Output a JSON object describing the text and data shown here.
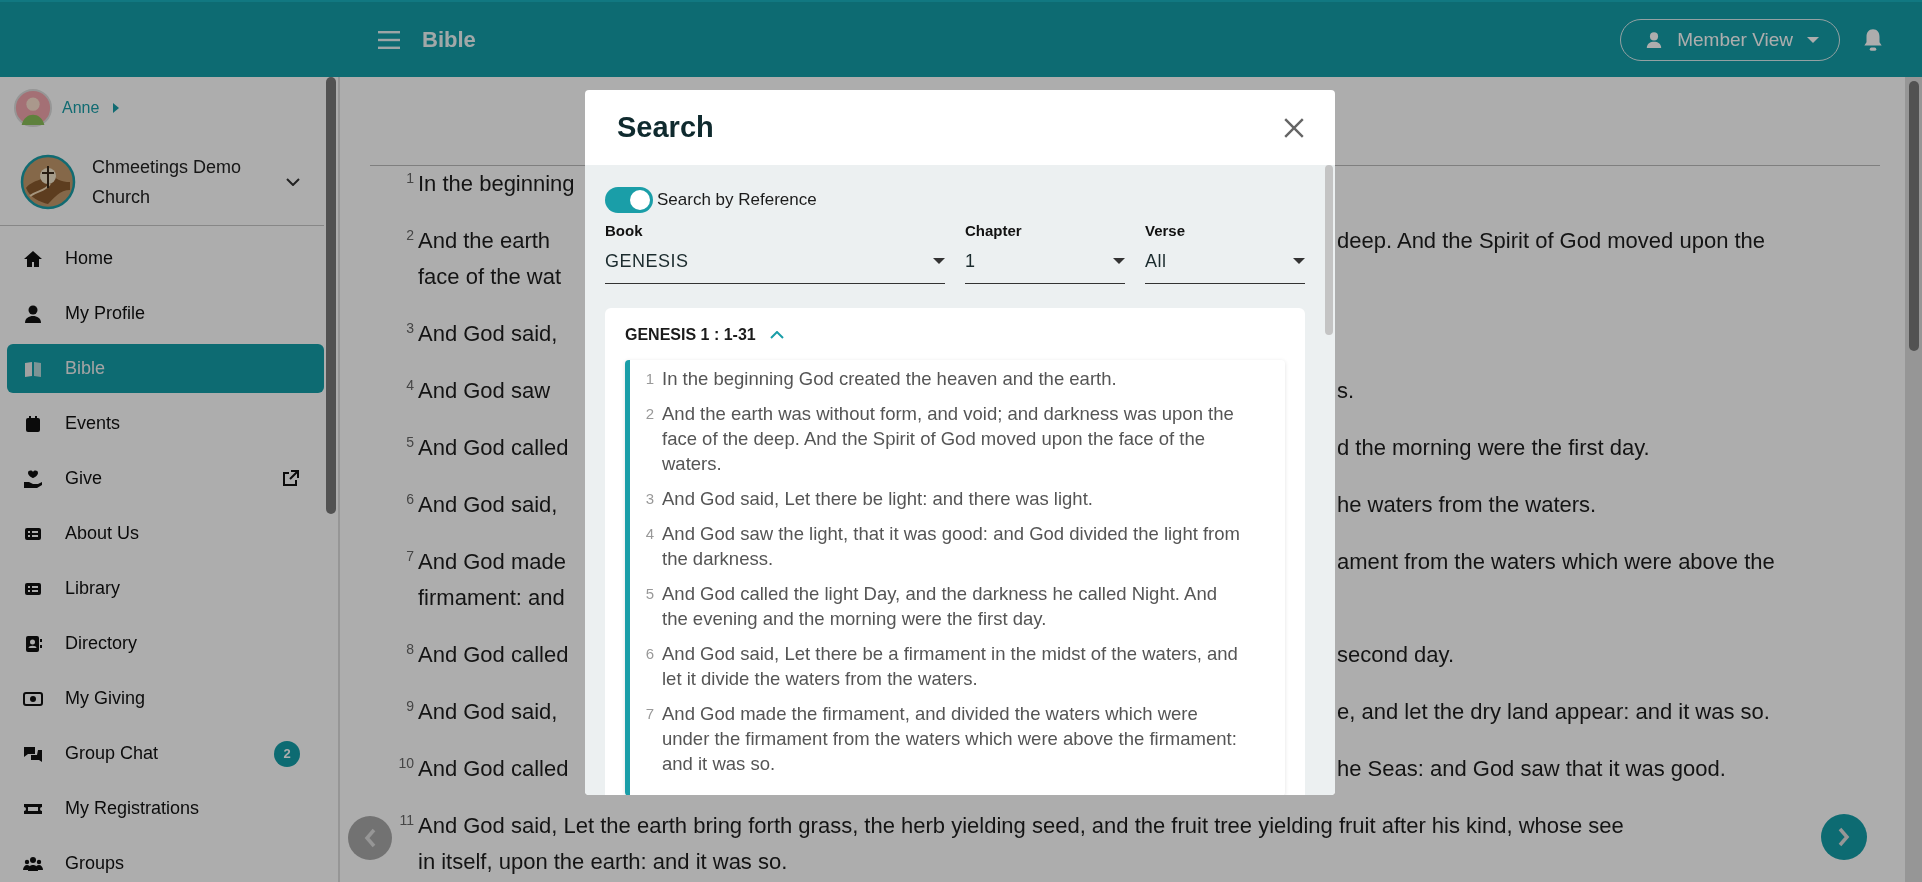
{
  "header": {
    "title": "Bible",
    "member_view": "Member View"
  },
  "sidebar": {
    "user": "Anne",
    "church": "Chmeetings Demo Church",
    "items": [
      {
        "kind": "home",
        "label": "Home",
        "selected": false
      },
      {
        "kind": "person",
        "label": "My Profile",
        "selected": false
      },
      {
        "kind": "book",
        "label": "Bible",
        "selected": true
      },
      {
        "kind": "calendar",
        "label": "Events",
        "selected": false
      },
      {
        "kind": "give",
        "label": "Give",
        "selected": false,
        "external": true
      },
      {
        "kind": "list",
        "label": "About Us",
        "selected": false
      },
      {
        "kind": "list",
        "label": "Library",
        "selected": false
      },
      {
        "kind": "contacts",
        "label": "Directory",
        "selected": false
      },
      {
        "kind": "cash",
        "label": "My Giving",
        "selected": false
      },
      {
        "kind": "chat",
        "label": "Group Chat",
        "selected": false,
        "badge": "2"
      },
      {
        "kind": "ticket",
        "label": "My Registrations",
        "selected": false
      },
      {
        "kind": "people",
        "label": "Groups",
        "selected": false
      }
    ]
  },
  "reader": {
    "verses": [
      {
        "number": "1",
        "lines": [
          {
            "left": "In the beginning"
          }
        ]
      },
      {
        "number": "2",
        "lines": [
          {
            "left": "And the earth",
            "right": "deep. And the Spirit of God moved upon the"
          },
          {
            "left": "face of the wat"
          }
        ]
      },
      {
        "number": "3",
        "lines": [
          {
            "left": "And God said,"
          }
        ]
      },
      {
        "number": "4",
        "lines": [
          {
            "left": "And God saw",
            "right": "s."
          }
        ]
      },
      {
        "number": "5",
        "lines": [
          {
            "left": "And God called",
            "right": "d the morning were the first day."
          }
        ]
      },
      {
        "number": "6",
        "lines": [
          {
            "left": "And God said,",
            "right": "he waters from the waters."
          }
        ]
      },
      {
        "number": "7",
        "lines": [
          {
            "left": "And God made",
            "right": "ament from the waters which were above the"
          },
          {
            "left": "firmament: and"
          }
        ]
      },
      {
        "number": "8",
        "lines": [
          {
            "left": "And God called",
            "right": "second day."
          }
        ]
      },
      {
        "number": "9",
        "lines": [
          {
            "left": "And God said,",
            "right": "e, and let the dry land appear: and it was so."
          }
        ]
      },
      {
        "number": "10",
        "lines": [
          {
            "left": "And God called",
            "right": "he Seas: and God saw that it was good."
          }
        ]
      },
      {
        "number": "11",
        "lines": [
          {
            "full": "And God said, Let the earth bring forth grass, the herb yielding seed, and the fruit tree yielding fruit after his kind, whose see"
          },
          {
            "full": "in itself, upon the earth: and it was so."
          }
        ]
      }
    ]
  },
  "search_dialog": {
    "title": "Search",
    "by_reference": {
      "label": "Search by Reference",
      "on": true
    },
    "fields": [
      {
        "label": "Book",
        "value": "GENESIS"
      },
      {
        "label": "Chapter",
        "value": "1"
      },
      {
        "label": "Verse",
        "value": "All"
      }
    ],
    "result": {
      "heading": "GENESIS 1 : 1-31",
      "expanded": true,
      "verses": [
        {
          "number": "1",
          "text": "In the beginning God created the heaven and the earth."
        },
        {
          "number": "2",
          "text": "And the earth was without form, and void; and darkness was upon the face of the deep. And the Spirit of God moved upon the face of the waters."
        },
        {
          "number": "3",
          "text": "And God said, Let there be light: and there was light."
        },
        {
          "number": "4",
          "text": "And God saw the light, that it was good: and God divided the light from the darkness."
        },
        {
          "number": "5",
          "text": "And God called the light Day, and the darkness he called Night. And the evening and the morning were the first day."
        },
        {
          "number": "6",
          "text": "And God said, Let there be a firmament in the midst of the waters, and let it divide the waters from the waters."
        },
        {
          "number": "7",
          "text": "And God made the firmament, and divided the waters which were under the firmament from the waters which were above the firmament: and it was so."
        }
      ]
    }
  }
}
